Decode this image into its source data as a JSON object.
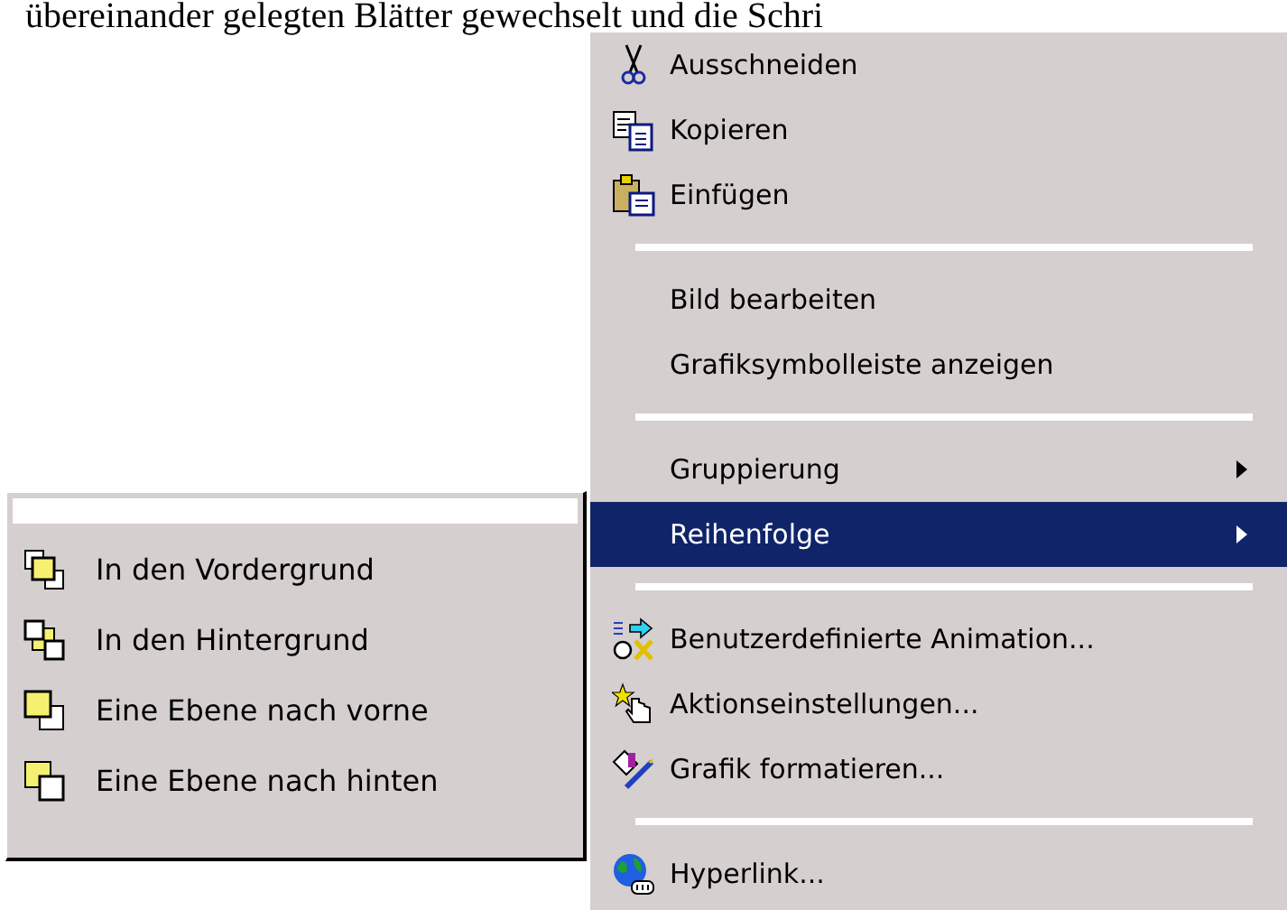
{
  "document_text": "übereinander gelegten Blätter gewechselt und die Schri",
  "context_menu": {
    "groups": [
      [
        {
          "label": "Ausschneiden",
          "selected": false,
          "has_submenu": false
        },
        {
          "label": "Kopieren",
          "selected": false,
          "has_submenu": false
        },
        {
          "label": "Einfügen",
          "selected": false,
          "has_submenu": false
        }
      ],
      [
        {
          "label": "Bild bearbeiten",
          "selected": false,
          "has_submenu": false
        },
        {
          "label": "Grafiksymbolleiste anzeigen",
          "selected": false,
          "has_submenu": false
        }
      ],
      [
        {
          "label": "Gruppierung",
          "selected": false,
          "has_submenu": true
        },
        {
          "label": "Reihenfolge",
          "selected": true,
          "has_submenu": true
        }
      ],
      [
        {
          "label": "Benutzerdefinierte Animation...",
          "selected": false,
          "has_submenu": false
        },
        {
          "label": "Aktionseinstellungen...",
          "selected": false,
          "has_submenu": false
        },
        {
          "label": "Grafik formatieren...",
          "selected": false,
          "has_submenu": false
        }
      ],
      [
        {
          "label": "Hyperlink...",
          "selected": false,
          "has_submenu": false
        }
      ]
    ]
  },
  "submenu": {
    "items": [
      {
        "label": "In den Vordergrund",
        "selected": false
      },
      {
        "label": "In den Hintergrund",
        "selected": false
      },
      {
        "label": "Eine Ebene nach vorne",
        "selected": false
      },
      {
        "label": "Eine Ebene nach hinten",
        "selected": false
      }
    ]
  }
}
